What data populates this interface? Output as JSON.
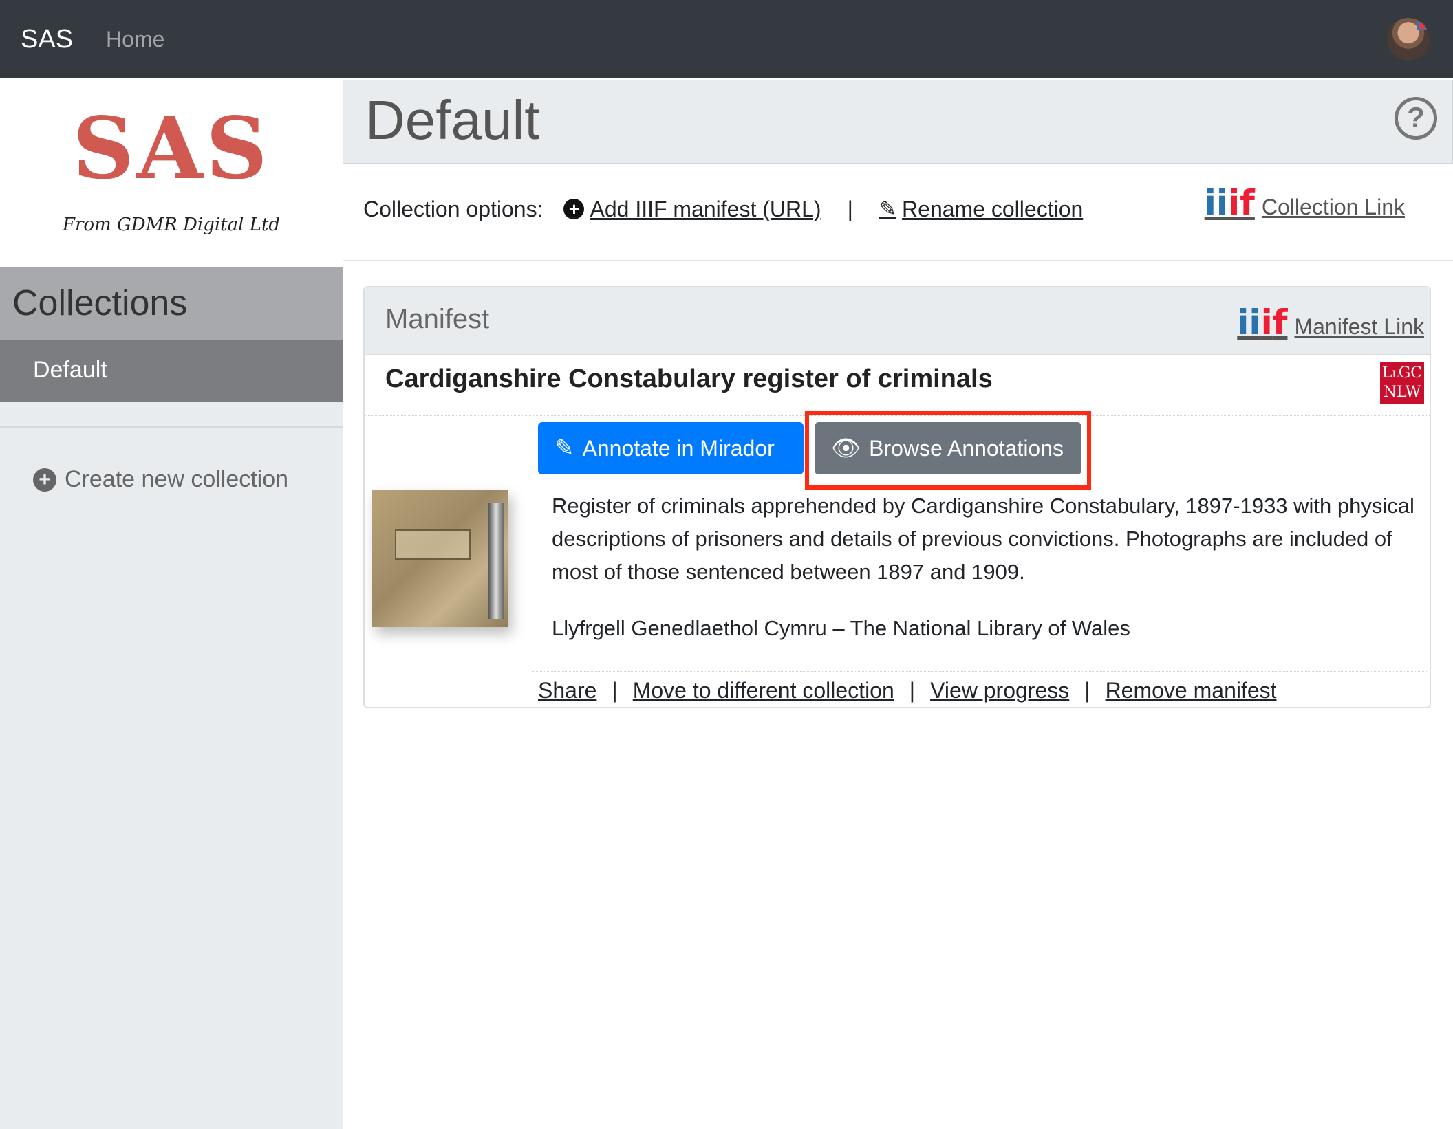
{
  "navbar": {
    "brand": "SAS",
    "home": "Home"
  },
  "sidebar": {
    "logo_text": "SAS",
    "logo_subtitle": "From GDMR Digital Ltd",
    "heading": "Collections",
    "items": [
      {
        "label": "Default",
        "active": true
      }
    ],
    "create_new": "Create new collection"
  },
  "header": {
    "title": "Default",
    "help_icon": "?"
  },
  "collection_options": {
    "label": "Collection options:",
    "add_manifest": "Add IIIF manifest (URL)",
    "separator": "|",
    "rename": "Rename collection",
    "collection_link": "Collection Link"
  },
  "manifest": {
    "header": "Manifest",
    "manifest_link": "Manifest Link",
    "title": "Cardiganshire Constabulary register of criminals",
    "provider_logo": "LlGC NLW",
    "annotate_button": "Annotate in Mirador",
    "browse_button": "Browse Annotations",
    "description": "Register of criminals apprehended by Cardiganshire Constabulary, 1897-1933 with physical descriptions of prisoners and details of previous convictions. Photographs are included of most of those sentenced between 1897 and 1909.",
    "attribution": "Llyfrgell Genedlaethol Cymru – The National Library of Wales",
    "actions": {
      "share": "Share",
      "move": "Move to different collection",
      "progress": "View progress",
      "remove": "Remove manifest",
      "sep": "|"
    }
  },
  "colors": {
    "navbar": "#343a40",
    "primary": "#007bff",
    "secondary": "#6c757d",
    "highlight": "#ff2a12",
    "logo_red": "#d05a52"
  }
}
